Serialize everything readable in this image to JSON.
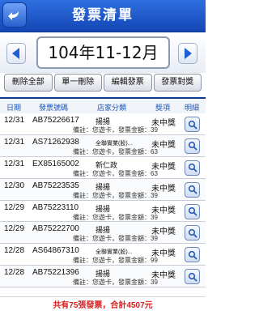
{
  "header": {
    "title": "發票清單"
  },
  "period": {
    "label": "104年11-12月"
  },
  "toolbar": {
    "buttons": [
      {
        "label": "刪除全部"
      },
      {
        "label": "單一刪除"
      },
      {
        "label": "編輯發票"
      },
      {
        "label": "發票對獎"
      }
    ]
  },
  "columns": {
    "date": "日期",
    "number": "發票號碼",
    "store": "店家分類",
    "prize": "獎項",
    "detail": "明細"
  },
  "invoices": [
    {
      "date": "12/31",
      "number": "AB75226617",
      "store": "揚揚",
      "prize": "未中獎",
      "note": "備註：您遊卡，發票金額：39"
    },
    {
      "date": "12/31",
      "number": "AS71262938",
      "store": "全聯實業(股)...",
      "prize": "未中獎",
      "note": "備註：您遊卡，發票金額：63"
    },
    {
      "date": "12/31",
      "number": "EX85165002",
      "store": "新仁政",
      "prize": "未中獎",
      "note": "備註：您遊卡，發票金額：63"
    },
    {
      "date": "12/30",
      "number": "AB75223535",
      "store": "揚揚",
      "prize": "未中獎",
      "note": "備註：您遊卡，發票金額：39"
    },
    {
      "date": "12/29",
      "number": "AB75223110",
      "store": "揚揚",
      "prize": "未中獎",
      "note": "備註：您遊卡，發票金額：39"
    },
    {
      "date": "12/29",
      "number": "AB75222700",
      "store": "揚揚",
      "prize": "未中獎",
      "note": "備註：您遊卡，發票金額：39"
    },
    {
      "date": "12/28",
      "number": "AS64867310",
      "store": "全聯實業(股)...",
      "prize": "未中獎",
      "note": "備註：您遊卡，發票金額：99"
    },
    {
      "date": "12/28",
      "number": "AB75221396",
      "store": "揚揚",
      "prize": "未中獎",
      "note": "備註：您遊卡，發票金額：39"
    }
  ],
  "footer": {
    "summary": "共有75張發票，合計4507元"
  }
}
